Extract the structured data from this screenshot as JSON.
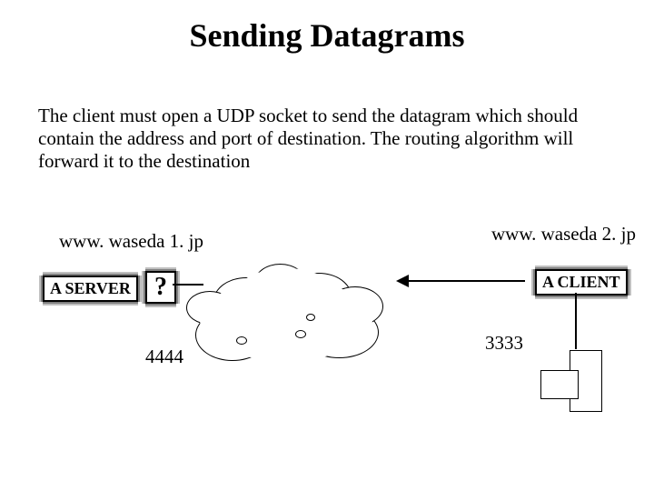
{
  "title": "Sending Datagrams",
  "description": "The client must open a UDP socket to send the datagram which should contain the address and port of destination. The routing algorithm will forward it to the destination",
  "left": {
    "url": "www. waseda 1. jp",
    "role": "A SERVER",
    "question": "?",
    "port": "4444"
  },
  "right": {
    "url": "www. waseda 2. jp",
    "role": "A CLIENT",
    "port": "3333"
  }
}
